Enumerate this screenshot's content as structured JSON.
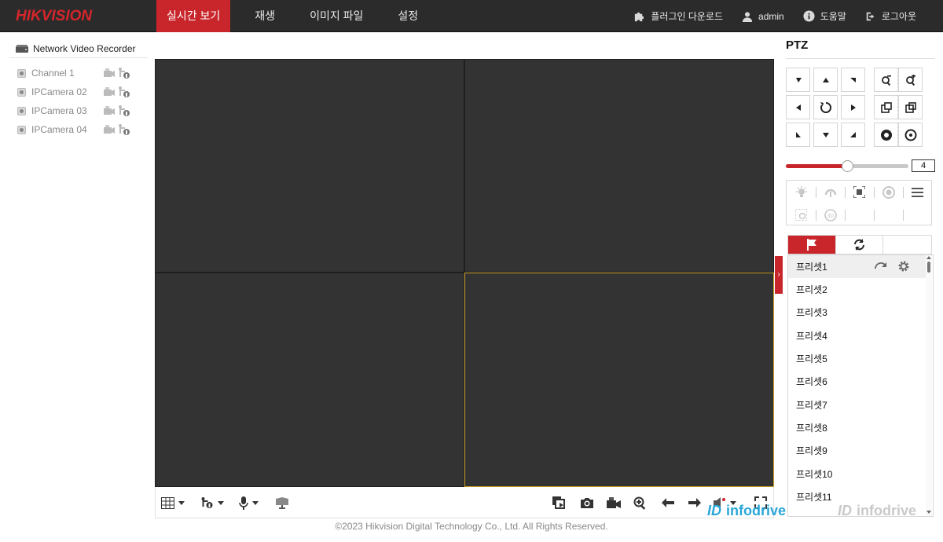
{
  "brand": {
    "logo_text": "HIKVISION",
    "accent_color": "#c9262c"
  },
  "nav": {
    "items": [
      {
        "label": "실시간 보기",
        "active": true
      },
      {
        "label": "재생",
        "active": false
      },
      {
        "label": "이미지 파일",
        "active": false
      },
      {
        "label": "설정",
        "active": false
      }
    ]
  },
  "top_right": {
    "plugin_label": "플러그인 다운로드",
    "user_label": "admin",
    "help_label": "도움말",
    "logout_label": "로그아웃"
  },
  "device_tree": {
    "root_label": "Network Video Recorder",
    "channels": [
      {
        "label": "Channel 1"
      },
      {
        "label": "IPCamera 02"
      },
      {
        "label": "IPCamera 03"
      },
      {
        "label": "IPCamera 04"
      }
    ]
  },
  "video": {
    "layout": "2x2",
    "selected_window": 4
  },
  "ptz": {
    "title": "PTZ",
    "speed_value": "4",
    "speed_fraction": 0.5,
    "tabs": [
      "preset-flag-icon",
      "patrol-refresh-icon",
      ""
    ],
    "presets": [
      "프리셋1",
      "프리셋2",
      "프리셋3",
      "프리셋4",
      "프리셋5",
      "프리셋6",
      "프리셋7",
      "프리셋8",
      "프리셋9",
      "프리셋10",
      "프리셋11"
    ]
  },
  "footer": {
    "copyright": "©2023 Hikvision Digital Technology Co., Ltd. All Rights Reserved."
  },
  "watermark": {
    "text": "infodrive",
    "mark": "ID"
  }
}
